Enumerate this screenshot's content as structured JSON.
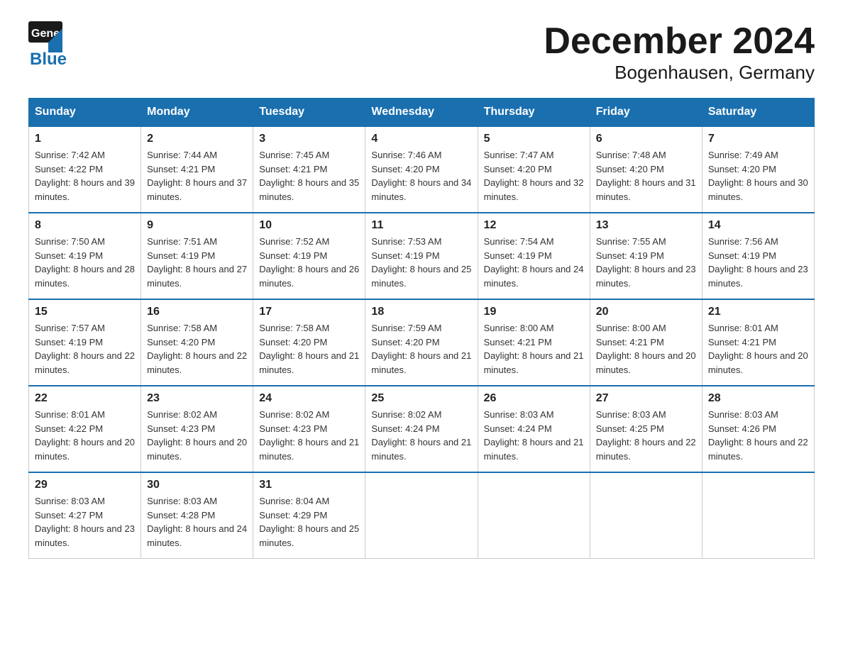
{
  "header": {
    "title": "December 2024",
    "subtitle": "Bogenhausen, Germany",
    "logo_general": "General",
    "logo_blue": "Blue"
  },
  "columns": [
    "Sunday",
    "Monday",
    "Tuesday",
    "Wednesday",
    "Thursday",
    "Friday",
    "Saturday"
  ],
  "weeks": [
    [
      {
        "day": "1",
        "sunrise": "Sunrise: 7:42 AM",
        "sunset": "Sunset: 4:22 PM",
        "daylight": "Daylight: 8 hours and 39 minutes."
      },
      {
        "day": "2",
        "sunrise": "Sunrise: 7:44 AM",
        "sunset": "Sunset: 4:21 PM",
        "daylight": "Daylight: 8 hours and 37 minutes."
      },
      {
        "day": "3",
        "sunrise": "Sunrise: 7:45 AM",
        "sunset": "Sunset: 4:21 PM",
        "daylight": "Daylight: 8 hours and 35 minutes."
      },
      {
        "day": "4",
        "sunrise": "Sunrise: 7:46 AM",
        "sunset": "Sunset: 4:20 PM",
        "daylight": "Daylight: 8 hours and 34 minutes."
      },
      {
        "day": "5",
        "sunrise": "Sunrise: 7:47 AM",
        "sunset": "Sunset: 4:20 PM",
        "daylight": "Daylight: 8 hours and 32 minutes."
      },
      {
        "day": "6",
        "sunrise": "Sunrise: 7:48 AM",
        "sunset": "Sunset: 4:20 PM",
        "daylight": "Daylight: 8 hours and 31 minutes."
      },
      {
        "day": "7",
        "sunrise": "Sunrise: 7:49 AM",
        "sunset": "Sunset: 4:20 PM",
        "daylight": "Daylight: 8 hours and 30 minutes."
      }
    ],
    [
      {
        "day": "8",
        "sunrise": "Sunrise: 7:50 AM",
        "sunset": "Sunset: 4:19 PM",
        "daylight": "Daylight: 8 hours and 28 minutes."
      },
      {
        "day": "9",
        "sunrise": "Sunrise: 7:51 AM",
        "sunset": "Sunset: 4:19 PM",
        "daylight": "Daylight: 8 hours and 27 minutes."
      },
      {
        "day": "10",
        "sunrise": "Sunrise: 7:52 AM",
        "sunset": "Sunset: 4:19 PM",
        "daylight": "Daylight: 8 hours and 26 minutes."
      },
      {
        "day": "11",
        "sunrise": "Sunrise: 7:53 AM",
        "sunset": "Sunset: 4:19 PM",
        "daylight": "Daylight: 8 hours and 25 minutes."
      },
      {
        "day": "12",
        "sunrise": "Sunrise: 7:54 AM",
        "sunset": "Sunset: 4:19 PM",
        "daylight": "Daylight: 8 hours and 24 minutes."
      },
      {
        "day": "13",
        "sunrise": "Sunrise: 7:55 AM",
        "sunset": "Sunset: 4:19 PM",
        "daylight": "Daylight: 8 hours and 23 minutes."
      },
      {
        "day": "14",
        "sunrise": "Sunrise: 7:56 AM",
        "sunset": "Sunset: 4:19 PM",
        "daylight": "Daylight: 8 hours and 23 minutes."
      }
    ],
    [
      {
        "day": "15",
        "sunrise": "Sunrise: 7:57 AM",
        "sunset": "Sunset: 4:19 PM",
        "daylight": "Daylight: 8 hours and 22 minutes."
      },
      {
        "day": "16",
        "sunrise": "Sunrise: 7:58 AM",
        "sunset": "Sunset: 4:20 PM",
        "daylight": "Daylight: 8 hours and 22 minutes."
      },
      {
        "day": "17",
        "sunrise": "Sunrise: 7:58 AM",
        "sunset": "Sunset: 4:20 PM",
        "daylight": "Daylight: 8 hours and 21 minutes."
      },
      {
        "day": "18",
        "sunrise": "Sunrise: 7:59 AM",
        "sunset": "Sunset: 4:20 PM",
        "daylight": "Daylight: 8 hours and 21 minutes."
      },
      {
        "day": "19",
        "sunrise": "Sunrise: 8:00 AM",
        "sunset": "Sunset: 4:21 PM",
        "daylight": "Daylight: 8 hours and 21 minutes."
      },
      {
        "day": "20",
        "sunrise": "Sunrise: 8:00 AM",
        "sunset": "Sunset: 4:21 PM",
        "daylight": "Daylight: 8 hours and 20 minutes."
      },
      {
        "day": "21",
        "sunrise": "Sunrise: 8:01 AM",
        "sunset": "Sunset: 4:21 PM",
        "daylight": "Daylight: 8 hours and 20 minutes."
      }
    ],
    [
      {
        "day": "22",
        "sunrise": "Sunrise: 8:01 AM",
        "sunset": "Sunset: 4:22 PM",
        "daylight": "Daylight: 8 hours and 20 minutes."
      },
      {
        "day": "23",
        "sunrise": "Sunrise: 8:02 AM",
        "sunset": "Sunset: 4:23 PM",
        "daylight": "Daylight: 8 hours and 20 minutes."
      },
      {
        "day": "24",
        "sunrise": "Sunrise: 8:02 AM",
        "sunset": "Sunset: 4:23 PM",
        "daylight": "Daylight: 8 hours and 21 minutes."
      },
      {
        "day": "25",
        "sunrise": "Sunrise: 8:02 AM",
        "sunset": "Sunset: 4:24 PM",
        "daylight": "Daylight: 8 hours and 21 minutes."
      },
      {
        "day": "26",
        "sunrise": "Sunrise: 8:03 AM",
        "sunset": "Sunset: 4:24 PM",
        "daylight": "Daylight: 8 hours and 21 minutes."
      },
      {
        "day": "27",
        "sunrise": "Sunrise: 8:03 AM",
        "sunset": "Sunset: 4:25 PM",
        "daylight": "Daylight: 8 hours and 22 minutes."
      },
      {
        "day": "28",
        "sunrise": "Sunrise: 8:03 AM",
        "sunset": "Sunset: 4:26 PM",
        "daylight": "Daylight: 8 hours and 22 minutes."
      }
    ],
    [
      {
        "day": "29",
        "sunrise": "Sunrise: 8:03 AM",
        "sunset": "Sunset: 4:27 PM",
        "daylight": "Daylight: 8 hours and 23 minutes."
      },
      {
        "day": "30",
        "sunrise": "Sunrise: 8:03 AM",
        "sunset": "Sunset: 4:28 PM",
        "daylight": "Daylight: 8 hours and 24 minutes."
      },
      {
        "day": "31",
        "sunrise": "Sunrise: 8:04 AM",
        "sunset": "Sunset: 4:29 PM",
        "daylight": "Daylight: 8 hours and 25 minutes."
      },
      null,
      null,
      null,
      null
    ]
  ]
}
